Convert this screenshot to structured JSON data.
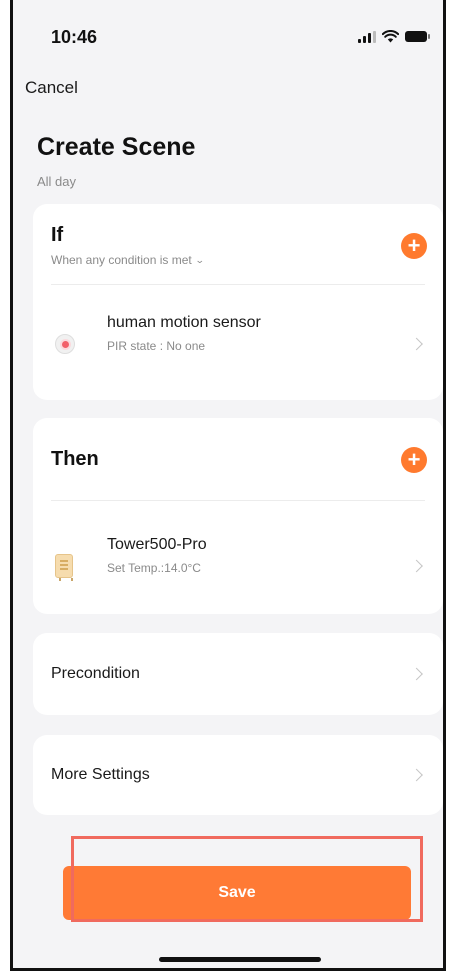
{
  "status_bar": {
    "time": "10:46"
  },
  "nav": {
    "cancel_label": "Cancel"
  },
  "header": {
    "title": "Create Scene",
    "subtitle": "All day"
  },
  "if_section": {
    "title": "If",
    "mode_label": "When any condition is met",
    "conditions": [
      {
        "icon": "motion-sensor-icon",
        "name": "human motion sensor",
        "detail": "PIR state : No one"
      }
    ]
  },
  "then_section": {
    "title": "Then",
    "actions": [
      {
        "icon": "heater-icon",
        "name": "Tower500-Pro",
        "detail": "Set Temp.:14.0°C"
      }
    ]
  },
  "precondition": {
    "label": "Precondition"
  },
  "more_settings": {
    "label": "More Settings"
  },
  "footer": {
    "save_label": "Save"
  },
  "colors": {
    "accent": "#ff7a35",
    "highlight": "#f06a5e",
    "background": "#f4f4f6"
  }
}
